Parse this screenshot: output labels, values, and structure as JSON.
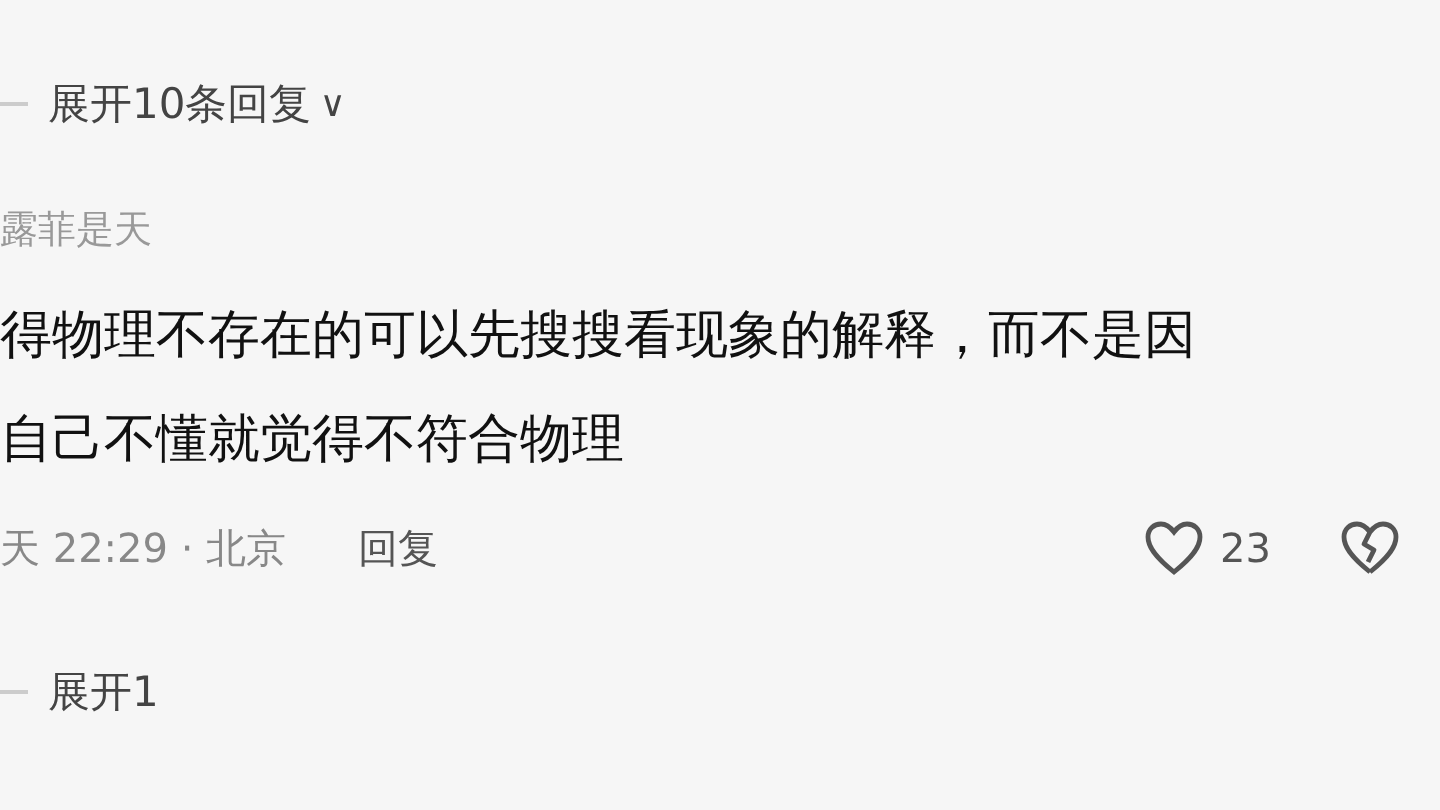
{
  "expand_top": {
    "label": "展开10条回复",
    "caret": "∨"
  },
  "comment": {
    "author": "露菲是天",
    "lines": [
      "得物理不存在的可以先搜搜看现象的解释，而不是因",
      "自己不懂就觉得不符合物理"
    ],
    "time": "天 22:29 · 北京",
    "reply": "回复",
    "likes": "23",
    "liked": false
  },
  "expand_bottom": {
    "label": "展开1"
  }
}
